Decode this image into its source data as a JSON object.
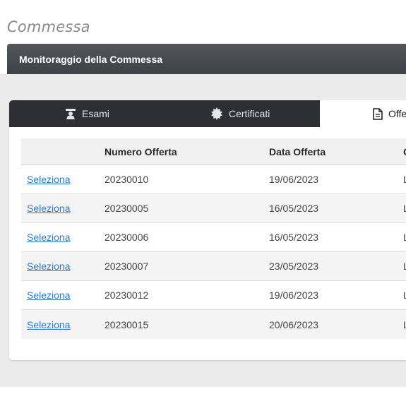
{
  "page": {
    "title": "Commessa"
  },
  "panel": {
    "title": "Monitoraggio della Commessa"
  },
  "tabs": [
    {
      "label": "Esami",
      "icon": "graduate-icon",
      "active": false
    },
    {
      "label": "Certificati",
      "icon": "certificate-seal-icon",
      "active": false
    },
    {
      "label": "Offe",
      "icon": "document-icon",
      "active": true
    }
  ],
  "table": {
    "columns": [
      "",
      "Numero Offerta",
      "Data Offerta",
      "C"
    ],
    "rows": [
      {
        "action": "Seleziona",
        "numero": "20230010",
        "data": "19/06/2023",
        "extra": "L"
      },
      {
        "action": "Seleziona",
        "numero": "20230005",
        "data": "16/05/2023",
        "extra": "L"
      },
      {
        "action": "Seleziona",
        "numero": "20230006",
        "data": "16/05/2023",
        "extra": "L"
      },
      {
        "action": "Seleziona",
        "numero": "20230007",
        "data": "23/05/2023",
        "extra": "L"
      },
      {
        "action": "Seleziona",
        "numero": "20230012",
        "data": "19/06/2023",
        "extra": "L"
      },
      {
        "action": "Seleziona",
        "numero": "20230015",
        "data": "20/06/2023",
        "extra": "L"
      }
    ]
  },
  "colors": {
    "header_bg": "#474b4f",
    "tabbar_bg": "#2c2f33",
    "link": "#2a7ac7",
    "body_bg": "#ebebeb"
  }
}
